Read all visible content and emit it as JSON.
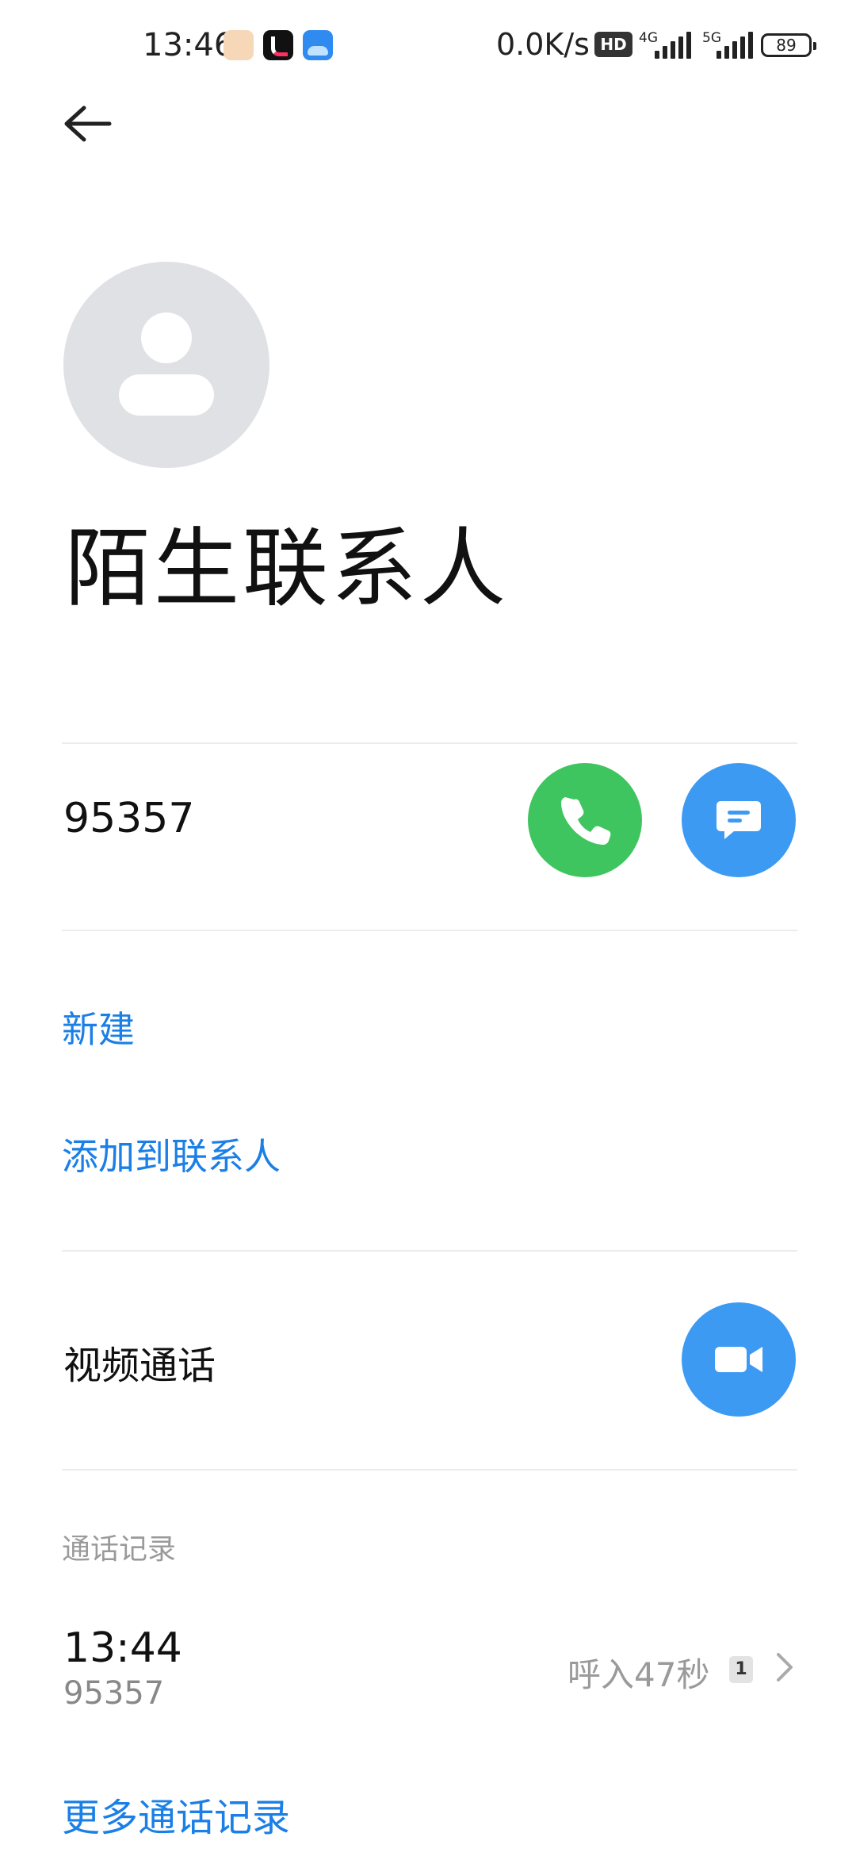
{
  "status_bar": {
    "time": "13:46",
    "net_speed": "0.0K/s",
    "hd": "HD",
    "signal1_label": "4G",
    "signal2_label": "5G",
    "battery": "89"
  },
  "contact": {
    "name": "陌生联系人",
    "number": "95357"
  },
  "actions": {
    "new": "新建",
    "add_to_contacts": "添加到联系人",
    "video_call": "视频通话"
  },
  "call_log": {
    "section_title": "通话记录",
    "entries": [
      {
        "time": "13:44",
        "number": "95357",
        "description": "呼入47秒",
        "sim": "1"
      }
    ],
    "more": "更多通话记录"
  },
  "colors": {
    "call_green": "#3ec55f",
    "action_blue": "#3d9af3",
    "link_blue": "#1a7fe6"
  }
}
